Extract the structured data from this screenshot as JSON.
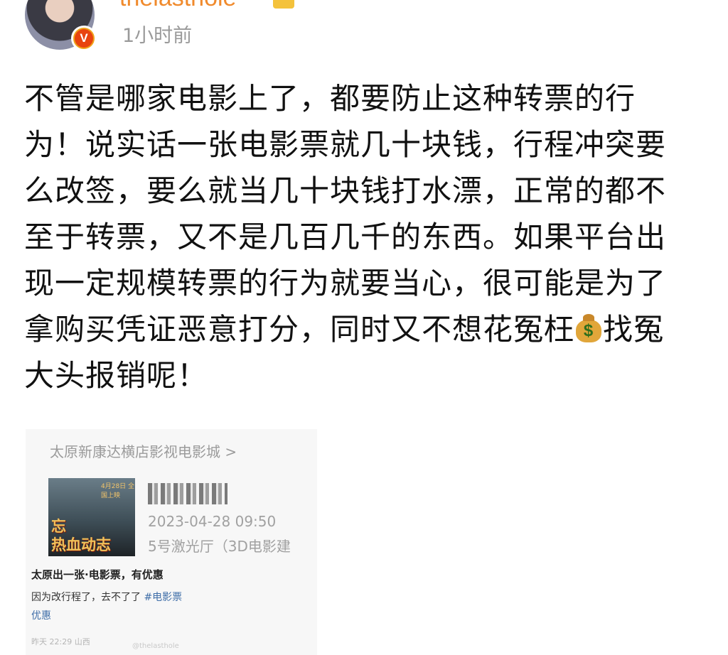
{
  "header": {
    "username": "thelasthole",
    "time": "1小时前"
  },
  "post": {
    "lines": [
      "不管是哪家电影上了，都要防止这种转票的行",
      "为！说实话一张电影票就几十块钱，行程冲突要",
      "么改签，要么就当几十块钱打水漂，正常的都不",
      "至于转票，又不是几百几千的东西。如果平台出",
      "现一定规模转票的行为就要当心，很可能是为了",
      "拿购买凭证恶意打分，同时又不想花冤枉",
      "找冤",
      "大头报销呢！"
    ],
    "emoji": "money-bag-icon"
  },
  "screenshot": {
    "cinema": "太原新康达横店影视电影城 >",
    "poster": {
      "tag": "4月28日 全国上映",
      "title_line1": "忘",
      "title_line2": "热血动志"
    },
    "order_time": "2023-04-28 09:50",
    "hall": "5号激光厅（3D电影建",
    "listing_title": "太原出一张·电影票，有优惠",
    "listing_body": "因为改行程了，去不了了",
    "hashtag": "#电影票",
    "listing_tail": "优惠",
    "meta": "昨天 22:29 山西",
    "watermark": "@thelasthole"
  }
}
